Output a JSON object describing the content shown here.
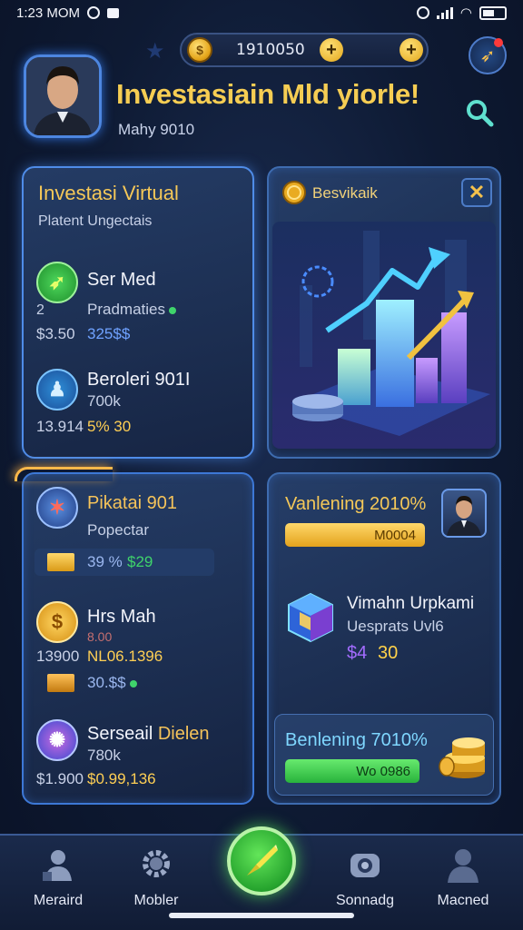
{
  "status_bar": {
    "time": "1:23 MOM"
  },
  "header": {
    "coin_balance": "1910050",
    "title": "Investasiain Mld yiorle!",
    "subtitle": "Mahy 9010"
  },
  "panel_left_top": {
    "title": "Investasi Virtual",
    "subtitle": "Platent Ungectais",
    "items": [
      {
        "icon": "rocket-icon",
        "title": "Ser Med",
        "qty": "2",
        "sub": "Pradmaties",
        "val_a": "$3.50",
        "val_b": "325$$"
      },
      {
        "icon": "person-icon",
        "title": "Beroleri 901I",
        "sub": "700k",
        "val_a": "13.914",
        "val_b": "5% 30"
      }
    ]
  },
  "panel_right_top": {
    "title": "Besvikaik"
  },
  "panel_left_bottom": {
    "items": [
      {
        "icon": "compass-icon",
        "title": "Pikatai 901",
        "sub": "Popectar",
        "val_a": "39 %",
        "val_b": "$29"
      },
      {
        "icon": "coin-icon",
        "title": "Hrs Mah",
        "sub": "8.00",
        "val_a": "13900",
        "val_b": "NL06.1396"
      },
      {
        "icon": "box-icon",
        "title": "",
        "sub": "",
        "val_a": "30.$$",
        "val_b": ""
      },
      {
        "icon": "nebula-icon",
        "title": "Serseail",
        "title_highlight": "Dielen",
        "sub": "780k",
        "val_a": "$1.900",
        "val_b": "$0.99,136"
      }
    ]
  },
  "panel_right_bottom": {
    "title": "Vanlening 2010%",
    "gold_pill": "M0004",
    "item_title": "Vimahn Urpkami",
    "item_sub": "Uesprats Uvl6",
    "item_val_a": "$4",
    "item_val_b": "30",
    "card_title": "Benlening 7010%",
    "green_pill": "Wo 0986"
  },
  "nav": {
    "items": [
      "Meraird",
      "Mobler",
      "Sonnadg",
      "Macned"
    ]
  }
}
